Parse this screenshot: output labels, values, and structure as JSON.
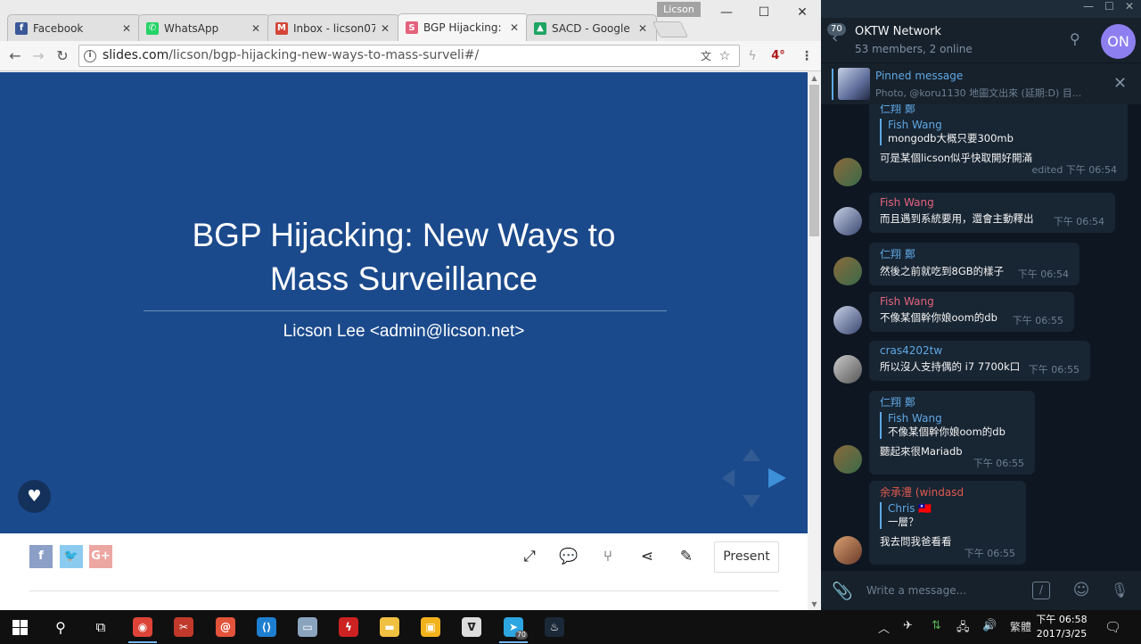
{
  "browser": {
    "profile_name": "Licson",
    "tabs": [
      {
        "title": "Facebook",
        "icon": "facebook-icon",
        "color": "#3b5998",
        "glyph": "f",
        "active": false
      },
      {
        "title": "WhatsApp",
        "icon": "whatsapp-icon",
        "color": "#25d366",
        "glyph": "✆",
        "active": false
      },
      {
        "title": "Inbox - licson07",
        "icon": "gmail-icon",
        "color": "#d44638",
        "glyph": "M",
        "active": false
      },
      {
        "title": "BGP Hijacking: N",
        "icon": "slides-icon",
        "color": "#e4637c",
        "glyph": "S",
        "active": true
      },
      {
        "title": "SACD - Google D",
        "icon": "google-drive-icon",
        "color": "#1fa463",
        "glyph": "▲",
        "active": false
      }
    ],
    "url_host": "slides.com",
    "url_path": "/licson/bgp-hijacking-new-ways-to-mass-surveli#/",
    "extension_badge": "4°"
  },
  "slide": {
    "title_line1": "BGP Hijacking: New Ways to",
    "title_line2": "Mass Surveillance",
    "subtitle": "Licson Lee <admin@licson.net>",
    "background_color": "#1b4a8c"
  },
  "slide_toolbar": {
    "social": [
      {
        "label": "f",
        "icon": "facebook-share-icon",
        "color": "#8c9fc7"
      },
      {
        "label": "🐦",
        "icon": "twitter-share-icon",
        "color": "#8ccbf0"
      },
      {
        "label": "G+",
        "icon": "google-plus-share-icon",
        "color": "#eca7a2"
      }
    ],
    "present_label": "Present"
  },
  "telegram": {
    "group_name": "OKTW Network",
    "members": "53 members, 2 online",
    "unread_count": "70",
    "avatar_initials": "ON",
    "pinned_title": "Pinned message",
    "pinned_text": "Photo, @koru1130 地圖文出來 (延期:D) 目...",
    "messages": [
      {
        "sender": "仁翔 鄭",
        "sender_color": "#5fa8e4",
        "quote_name": "Fish Wang",
        "quote_text": "mongodb大概只要300mb",
        "text": "可是某個licson似乎快取開好開滿",
        "time": "edited 下午 06:54"
      },
      {
        "sender": "Fish Wang",
        "sender_color": "#e4637c",
        "text": "而且遇到系統要用，還會主動釋出",
        "time": "下午 06:54"
      },
      {
        "sender": "仁翔 鄭",
        "sender_color": "#5fa8e4",
        "text": "然後之前就吃到8GB的樣子",
        "time": "下午 06:54"
      },
      {
        "sender": "Fish Wang",
        "sender_color": "#e4637c",
        "text": "不像某個幹你娘oom的db",
        "time": "下午 06:55"
      },
      {
        "sender": "cras4202tw",
        "sender_color": "#5fa8e4",
        "text": "所以沒人支持偶的 i7 7700k口",
        "time": "下午 06:55"
      },
      {
        "sender": "仁翔 鄭",
        "sender_color": "#5fa8e4",
        "quote_name": "Fish Wang",
        "quote_text": "不像某個幹你娘oom的db",
        "text": "聽起來很Mariadb",
        "time": "下午 06:55"
      },
      {
        "sender": "余承澧 (windasd",
        "sender_color": "#e05a4f",
        "quote_name": "Chris 🇹🇼",
        "quote_text": "一層？",
        "text": "我去問我爸看看",
        "time": "下午 06:55"
      }
    ],
    "composer_placeholder": "Write a message..."
  },
  "taskbar": {
    "apps": [
      {
        "icon": "chrome-icon",
        "color": "#db4437",
        "glyph": "◉"
      },
      {
        "icon": "snipping-icon",
        "color": "#c0392b",
        "glyph": "✂"
      },
      {
        "icon": "shell-app-icon",
        "color": "#e2533a",
        "glyph": "@"
      },
      {
        "icon": "vscode-icon",
        "color": "#1e7fd1",
        "glyph": "⟨⟩"
      },
      {
        "icon": "remote-desktop-icon",
        "color": "#8aa4be",
        "glyph": "▭"
      },
      {
        "icon": "flash-icon",
        "color": "#cc2222",
        "glyph": "ϟ"
      },
      {
        "icon": "file-explorer-icon",
        "color": "#f0c040",
        "glyph": "▬"
      },
      {
        "icon": "sticky-app-icon",
        "color": "#f2b21c",
        "glyph": "▣"
      },
      {
        "icon": "fox-app-icon",
        "color": "#dddddd",
        "glyph": "ᐁ"
      },
      {
        "icon": "telegram-icon",
        "color": "#2ca5e0",
        "glyph": "➤"
      },
      {
        "icon": "steam-icon",
        "color": "#1b2838",
        "glyph": "♨"
      }
    ],
    "telegram_badge": "70",
    "language": "繁體",
    "time": "下午 06:58",
    "date": "2017/3/25"
  }
}
